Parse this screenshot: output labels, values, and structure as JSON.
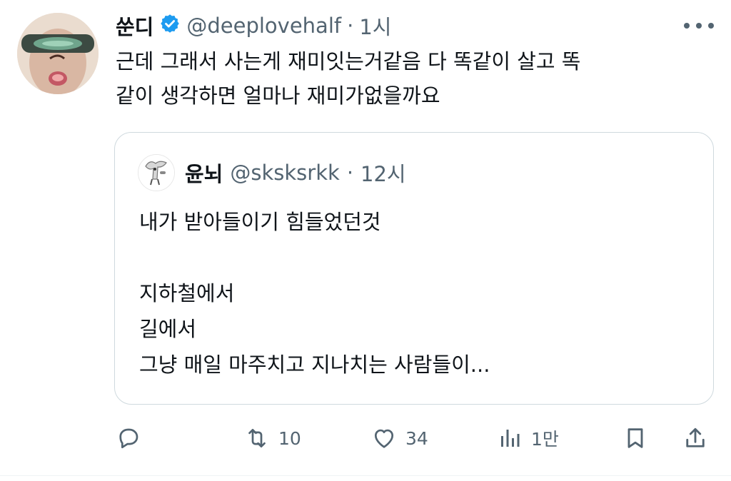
{
  "tweet": {
    "author_name": "쑨디",
    "handle": "@deeplovehalf",
    "separator": "·",
    "time": "1시",
    "text": "근데 그래서 사는게 재미잇는거같음 다 똑같이 살고 똑\n같이 생각하면 얼마나 재미가없을까요"
  },
  "quote": {
    "author_name": "윤뇌",
    "handle": "@sksksrkk",
    "separator": "·",
    "time": "12시",
    "text": "내가 받아들이기 힘들었던것\n\n지하철에서\n길에서\n그냥 매일 마주치고 지나치는 사람들이..."
  },
  "actions": {
    "reply_count": "",
    "retweet_count": "10",
    "like_count": "34",
    "views_count": "1만"
  },
  "icons": {
    "verified": "verified-badge-icon",
    "more": "more-icon",
    "reply": "reply-icon",
    "retweet": "retweet-icon",
    "like": "heart-icon",
    "views": "views-icon",
    "bookmark": "bookmark-icon",
    "share": "share-icon"
  },
  "colors": {
    "verified": "#1d9bf0",
    "secondary_text": "#536471",
    "border": "#cfd9de"
  }
}
